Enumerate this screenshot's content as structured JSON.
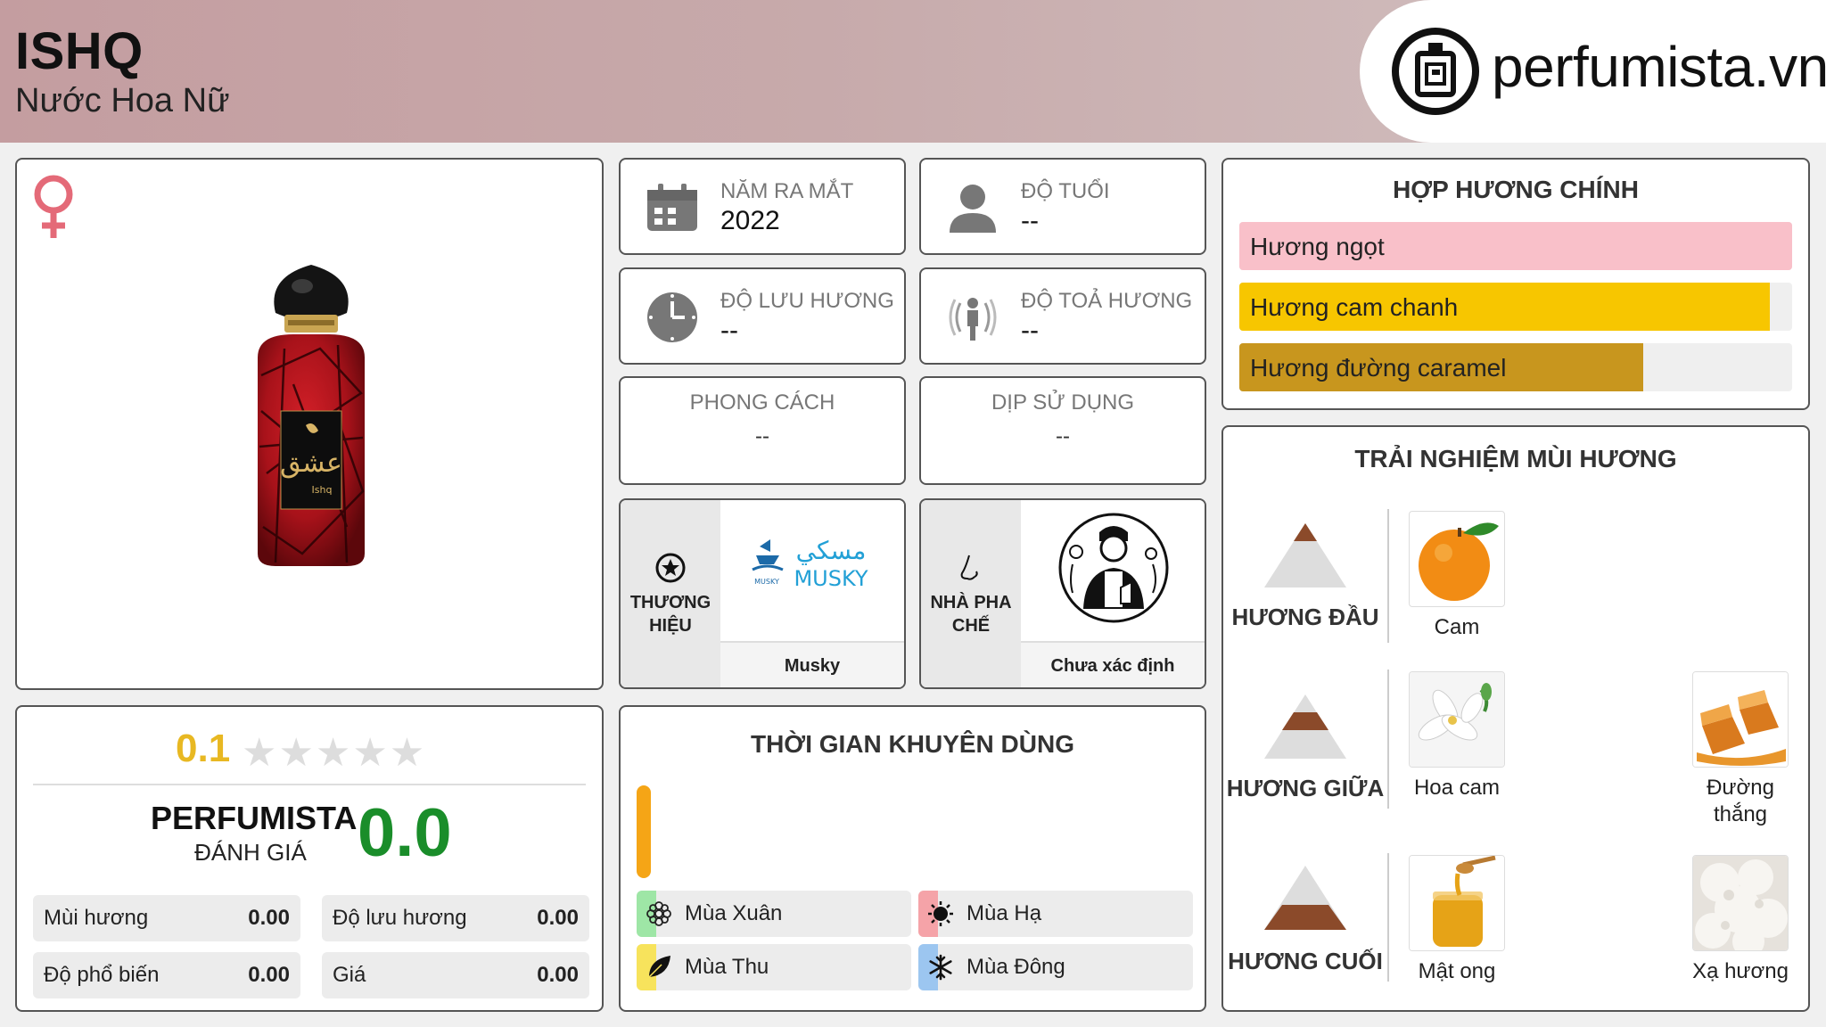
{
  "header": {
    "title": "ISHQ",
    "subtitle": "Nước Hoa Nữ",
    "logo_text": "perfumista.vn"
  },
  "product": {
    "gender_icon": "female-icon",
    "bottle_label_script": "عشق",
    "bottle_label_text": "Ishq"
  },
  "info": {
    "launch_year": {
      "label": "NĂM RA MẮT",
      "value": "2022"
    },
    "age": {
      "label": "ĐỘ TUỔI",
      "value": "--"
    },
    "longevity": {
      "label": "ĐỘ LƯU HƯƠNG",
      "value": "--"
    },
    "sillage": {
      "label": "ĐỘ TOẢ HƯƠNG",
      "value": "--"
    },
    "style": {
      "label": "PHONG CÁCH",
      "value": "--"
    },
    "occasion": {
      "label": "DỊP SỬ DỤNG",
      "value": "--"
    }
  },
  "brand": {
    "label_line1": "THƯƠNG",
    "label_line2": "HIỆU",
    "name": "Musky",
    "logo_text": "MUSKY",
    "logo_arabic": "مسكي",
    "logo_small": "MUSKY"
  },
  "perfumer": {
    "label_line1": "NHÀ PHA",
    "label_line2": "CHẾ",
    "name": "Chưa xác định"
  },
  "accords": {
    "title": "HỢP HƯƠNG CHÍNH",
    "items": [
      {
        "label": "Hương ngọt",
        "fill": 1.0,
        "color": "#f9c0c9"
      },
      {
        "label": "Hương cam chanh",
        "fill": 0.96,
        "color": "#f7c600"
      },
      {
        "label": "Hương đường caramel",
        "fill": 0.73,
        "color": "#c8961e"
      }
    ]
  },
  "ratings": {
    "user_score": "0.1",
    "stars": "★★★★★",
    "perfumista_label": "PERFUMISTA",
    "perfumista_sub": "ĐÁNH GIÁ",
    "perfumista_score": "0.0",
    "metrics": [
      {
        "label": "Mùi hương",
        "value": "0.00"
      },
      {
        "label": "Độ lưu hương",
        "value": "0.00"
      },
      {
        "label": "Độ phổ biến",
        "value": "0.00"
      },
      {
        "label": "Giá",
        "value": "0.00"
      }
    ]
  },
  "usage": {
    "title": "THỜI GIAN KHUYÊN DÙNG",
    "seasons": [
      {
        "label": "Mùa Xuân",
        "color": "#9ee6a6",
        "icon": "flower-icon"
      },
      {
        "label": "Mùa Hạ",
        "color": "#f5a3a8",
        "icon": "sun-icon"
      },
      {
        "label": "Mùa Thu",
        "color": "#f7e35c",
        "icon": "leaf-icon"
      },
      {
        "label": "Mùa Đông",
        "color": "#9cc6f0",
        "icon": "snowflake-icon"
      }
    ]
  },
  "notes": {
    "title": "TRẢI NGHIỆM MÙI HƯƠNG",
    "top": {
      "label": "HƯƠNG ĐẦU",
      "items": [
        {
          "name": "Cam",
          "icon": "orange-icon"
        }
      ]
    },
    "middle": {
      "label": "HƯƠNG GIỮA",
      "items": [
        {
          "name": "Hoa cam",
          "icon": "orange-blossom-icon"
        },
        {
          "name_line1": "Đường",
          "name_line2": "thắng",
          "icon": "caramel-icon"
        }
      ]
    },
    "base": {
      "label": "HƯƠNG CUỐI",
      "items": [
        {
          "name": "Mật ong",
          "icon": "honey-icon"
        },
        {
          "name": "Xạ hương",
          "icon": "musk-icon"
        }
      ]
    }
  }
}
